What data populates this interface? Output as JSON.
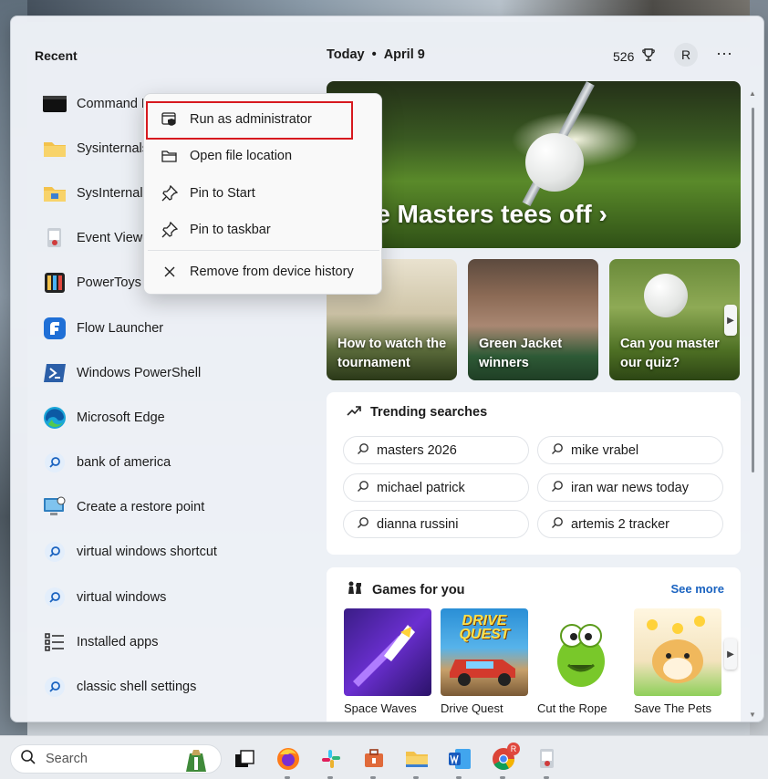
{
  "recent": {
    "title": "Recent",
    "items": [
      {
        "label": "Command Prompt",
        "icon": "command-prompt-icon"
      },
      {
        "label": "Sysinternals",
        "icon": "folder-icon"
      },
      {
        "label": "SysInternals",
        "icon": "folder-icon"
      },
      {
        "label": "Event Viewer",
        "icon": "event-viewer-icon"
      },
      {
        "label": "PowerToys",
        "icon": "powertoys-icon"
      },
      {
        "label": "Flow Launcher",
        "icon": "flow-launcher-icon"
      },
      {
        "label": "Windows PowerShell",
        "icon": "powershell-icon"
      },
      {
        "label": "Microsoft Edge",
        "icon": "edge-icon"
      },
      {
        "label": "bank of america",
        "icon": "search-icon"
      },
      {
        "label": "Create a restore point",
        "icon": "restore-point-icon"
      },
      {
        "label": "virtual windows shortcut",
        "icon": "search-icon"
      },
      {
        "label": "virtual windows",
        "icon": "search-icon"
      },
      {
        "label": "Installed apps",
        "icon": "installed-apps-icon"
      },
      {
        "label": "classic shell settings",
        "icon": "search-icon"
      }
    ]
  },
  "feed": {
    "today": "Today",
    "date": "April 9",
    "points": "526",
    "avatar_letter": "R",
    "more": "···",
    "hero_title": "The Masters tees off ›",
    "news": [
      {
        "caption": "How to watch the tournament"
      },
      {
        "caption": "Green Jacket winners"
      },
      {
        "caption": "Can you master our quiz?"
      }
    ],
    "trending": {
      "title": "Trending searches",
      "items": [
        "masters 2026",
        "mike vrabel",
        "michael patrick",
        "iran war news today",
        "dianna russini",
        "artemis 2 tracker"
      ]
    },
    "games": {
      "title": "Games for you",
      "see_more": "See more",
      "items": [
        {
          "name": "Space Waves",
          "art_color": "#5b2bb0"
        },
        {
          "name": "Drive Quest",
          "art_color": "#1f7fc4",
          "art_text": "DRIVE QUEST"
        },
        {
          "name": "Cut the Rope",
          "art_color": "#ffffff"
        },
        {
          "name": "Save The Pets",
          "art_color": "#f3e6c8"
        }
      ]
    }
  },
  "context_menu": {
    "items": [
      {
        "label": "Run as administrator",
        "icon": "shield-admin-icon",
        "highlighted": true
      },
      {
        "label": "Open file location",
        "icon": "folder-open-icon"
      },
      {
        "label": "Pin to Start",
        "icon": "pin-icon"
      },
      {
        "label": "Pin to taskbar",
        "icon": "pin-icon"
      },
      {
        "label": "Remove from device history",
        "icon": "close-icon"
      }
    ]
  },
  "taskbar": {
    "search_placeholder": "Search",
    "apps": [
      "task-view-icon",
      "firefox-icon",
      "slack-icon",
      "toolbox-icon",
      "file-explorer-icon",
      "word-icon",
      "chrome-icon",
      "event-viewer-icon"
    ],
    "chrome_badge": "R"
  },
  "colors": {
    "accent_link": "#1a63c0",
    "highlight_border": "#d7191f"
  }
}
